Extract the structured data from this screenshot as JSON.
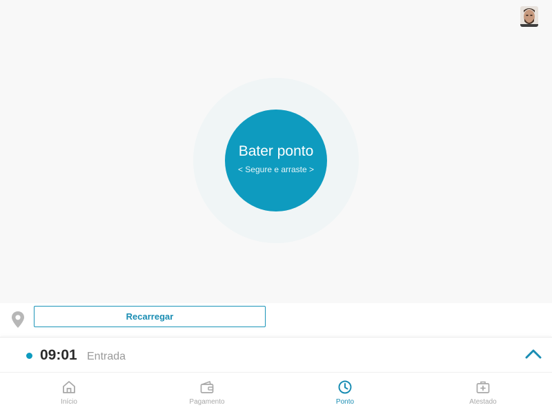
{
  "colors": {
    "accent": "#0e9bbf",
    "background": "#f8f8f8",
    "inactive": "#a8a8a8"
  },
  "header": {
    "avatar_icon": "user-avatar"
  },
  "punch": {
    "title": "Bater ponto",
    "hint": "< Segure e arraste >"
  },
  "location": {
    "icon": "map-pin-icon",
    "reload_label": "Recarregar"
  },
  "record": {
    "time": "09:01",
    "label": "Entrada",
    "expand_icon": "chevron-up-icon"
  },
  "nav": {
    "items": [
      {
        "label": "Início",
        "icon": "home-icon",
        "active": false
      },
      {
        "label": "Pagamento",
        "icon": "wallet-icon",
        "active": false
      },
      {
        "label": "Ponto",
        "icon": "clock-icon",
        "active": true
      },
      {
        "label": "Atestado",
        "icon": "medical-kit-icon",
        "active": false
      }
    ]
  }
}
